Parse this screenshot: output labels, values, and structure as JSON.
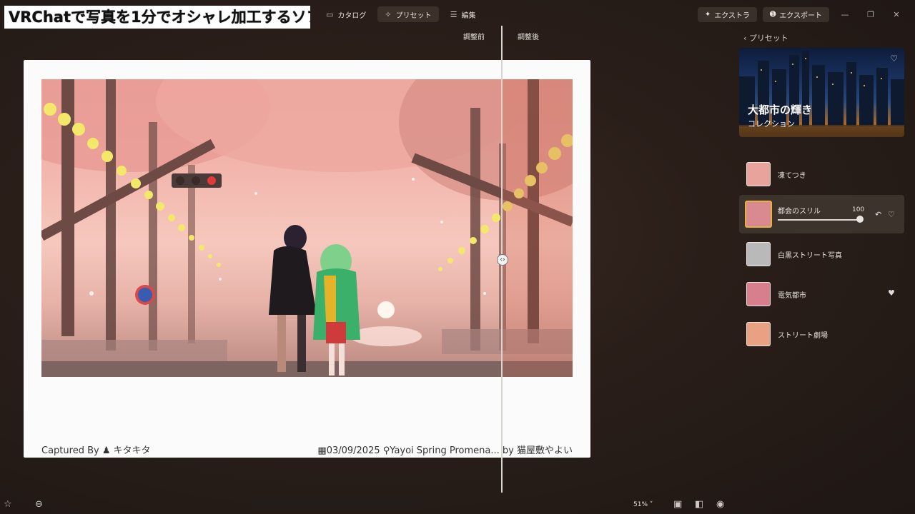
{
  "video_title": "VRChatで写真を1分でオシャレ加工するソフト",
  "nav": {
    "tabs": [
      {
        "icon": "folder-icon",
        "glyph": "▭",
        "label": "カタログ",
        "active": false
      },
      {
        "icon": "wand-icon",
        "glyph": "✧",
        "label": "プリセット",
        "active": true
      },
      {
        "icon": "sliders-icon",
        "glyph": "☰",
        "label": "編集",
        "active": false
      }
    ]
  },
  "topright": {
    "extra_label": "エクストラ",
    "export_label": "エクスポート"
  },
  "compare": {
    "before_label": "調整前",
    "after_label": "調整後"
  },
  "card": {
    "captured_by_label": "Captured By",
    "author": "キタキタ",
    "date": "03/09/2025",
    "location": "Yayoi Spring Promena...",
    "by_text": "by 猫屋敷やよい"
  },
  "sidebar": {
    "back_label": "プリセット",
    "banner_title": "大都市の輝き",
    "banner_subtitle": "コレクション",
    "presets": [
      {
        "name": "凍てつき",
        "favorite": false,
        "active": false,
        "thumb_color": "#e8a49c"
      },
      {
        "name": "都会のスリル",
        "favorite": false,
        "active": true,
        "value": "100",
        "thumb_color": "#d98a90"
      },
      {
        "name": "白黒ストリート写真",
        "favorite": false,
        "active": false,
        "thumb_color": "#b9b9b9"
      },
      {
        "name": "電気都市",
        "favorite": true,
        "active": false,
        "thumb_color": "#d87f8e"
      },
      {
        "name": "ストリート劇場",
        "favorite": false,
        "active": false,
        "thumb_color": "#e8a283"
      }
    ]
  },
  "bottombar": {
    "zoom": "51%"
  }
}
